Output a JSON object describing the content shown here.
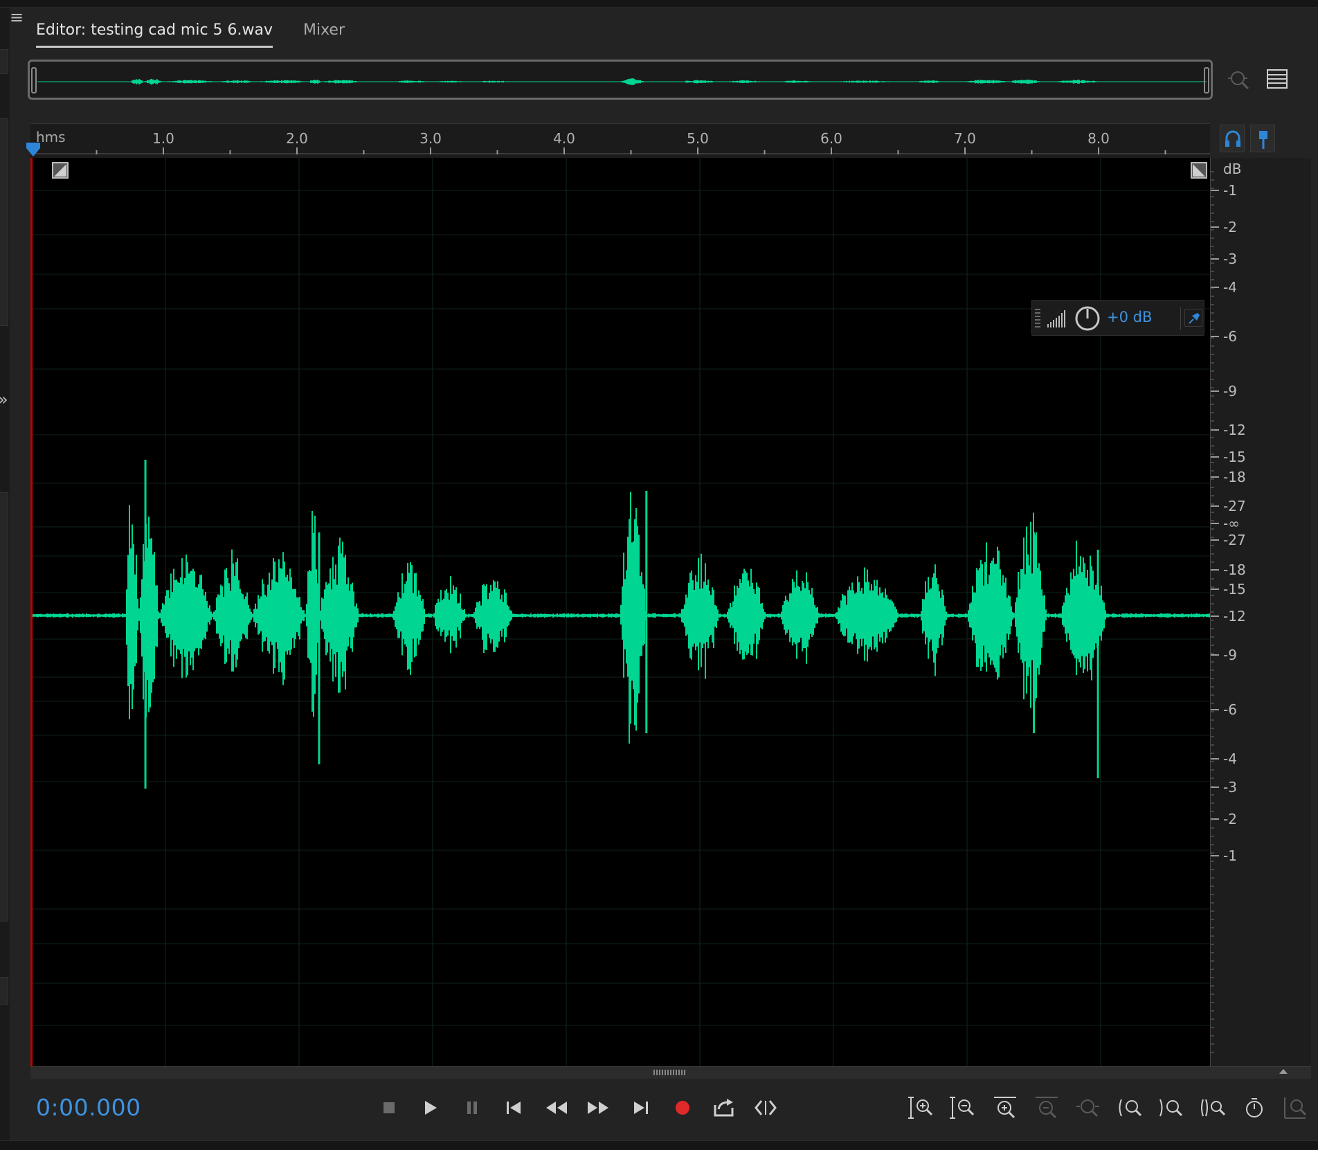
{
  "tabs": {
    "editor_label": "Editor: testing cad mic  5 6.wav",
    "mixer_label": "Mixer"
  },
  "ruler": {
    "unit": "hms",
    "ticks": [
      "1.0",
      "2.0",
      "3.0",
      "4.0",
      "5.0",
      "6.0",
      "7.0",
      "8.0"
    ],
    "range_seconds": [
      0.0,
      8.85
    ]
  },
  "hud": {
    "gain_value": "+0 dB"
  },
  "db_scale": {
    "header": "dB",
    "top_half": [
      "-1",
      "-2",
      "-3",
      "-4",
      "-6",
      "-9",
      "-12",
      "-15",
      "-18",
      "-27",
      "-∞"
    ],
    "bottom_half": [
      "-27",
      "-18",
      "-15",
      "-12",
      "-9",
      "-6",
      "-4",
      "-3",
      "-2",
      "-1"
    ]
  },
  "transport": {
    "timecode": "0:00.000"
  },
  "colors": {
    "waveform": "#00d592",
    "accent_blue": "#3e93e0",
    "record_red": "#e02a2a",
    "playhead_red": "#c00000"
  },
  "icons": {
    "tab_menu": "hamburger-icon",
    "overview_zoom": "zoom-selection-icon",
    "overview_list": "list-icon",
    "headphone": "headphone-icon",
    "marker": "playhead-marker-icon",
    "hud_pin": "pin-icon"
  }
}
